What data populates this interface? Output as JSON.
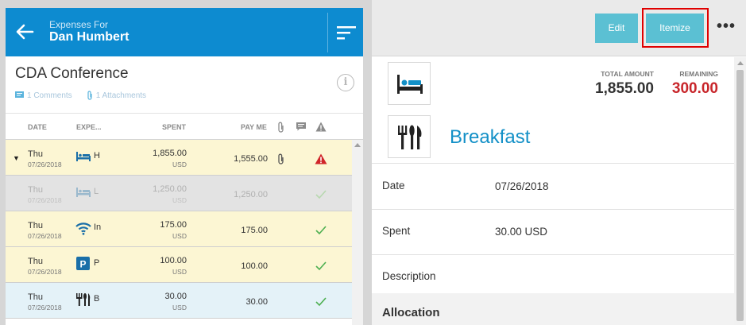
{
  "left_panel": {
    "header": {
      "subtitle": "Expenses For",
      "title": "Dan Humbert"
    },
    "report": {
      "title": "CDA Conference",
      "comments": "1 Comments",
      "attachments": "1 Attachments"
    },
    "columns": {
      "date": "DATE",
      "expense": "EXPE...",
      "spent": "SPENT",
      "payme": "PAY ME"
    },
    "rows": [
      {
        "day": "Thu",
        "date": "07/26/2018",
        "name": "H",
        "icon": "hotel-bed-icon",
        "spent": "1,855.00",
        "currency": "USD",
        "payme": "1,555.00",
        "attachment": true,
        "status": "warning"
      },
      {
        "day": "Thu",
        "date": "07/26/2018",
        "name": "L",
        "icon": "hotel-bed-icon",
        "spent": "1,250.00",
        "currency": "USD",
        "payme": "1,250.00",
        "attachment": false,
        "status": "check"
      },
      {
        "day": "Thu",
        "date": "07/26/2018",
        "name": "In",
        "icon": "wifi-icon",
        "spent": "175.00",
        "currency": "USD",
        "payme": "175.00",
        "attachment": false,
        "status": "check"
      },
      {
        "day": "Thu",
        "date": "07/26/2018",
        "name": "P",
        "icon": "parking-icon",
        "spent": "100.00",
        "currency": "USD",
        "payme": "100.00",
        "attachment": false,
        "status": "check"
      },
      {
        "day": "Thu",
        "date": "07/26/2018",
        "name": "B",
        "icon": "fork-knife-icon",
        "spent": "30.00",
        "currency": "USD",
        "payme": "30.00",
        "attachment": false,
        "status": "check"
      }
    ]
  },
  "right_panel": {
    "buttons": {
      "edit": "Edit",
      "itemize": "Itemize",
      "more": "•••"
    },
    "total_label": "TOTAL AMOUNT",
    "total_value": "1,855.00",
    "remaining_label": "REMAINING",
    "remaining_value": "300.00",
    "category": "Breakfast",
    "fields": [
      {
        "label": "Date",
        "value": "07/26/2018"
      },
      {
        "label": "Spent",
        "value": "30.00 USD"
      },
      {
        "label": "Description",
        "value": ""
      }
    ],
    "allocation_heading": "Allocation"
  },
  "colors": {
    "header_blue": "#0d8bd0",
    "button_teal": "#5bc0d3",
    "remaining_red": "#c8262b",
    "category_blue": "#1390c7",
    "highlight_red": "#e00000"
  }
}
